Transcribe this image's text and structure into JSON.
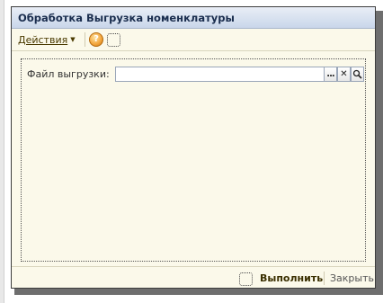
{
  "window": {
    "title": "Обработка  Выгрузка номенклатуры"
  },
  "toolbar": {
    "actions_label": "Действия",
    "help_label": "?",
    "help_icon": "help-question-icon",
    "customize_icon": "dotted-frame-icon"
  },
  "form": {
    "file_label": "Файл выгрузки:",
    "file_value": "",
    "select_label": "...",
    "clear_label": "✕",
    "open_label": "🔍"
  },
  "footer": {
    "run_label": "Выполнить",
    "close_label": "Закрыть"
  },
  "colors": {
    "title_bar": "#c9d6ea",
    "form_background": "#fbf9ea",
    "help_accent": "#f2a33a"
  }
}
